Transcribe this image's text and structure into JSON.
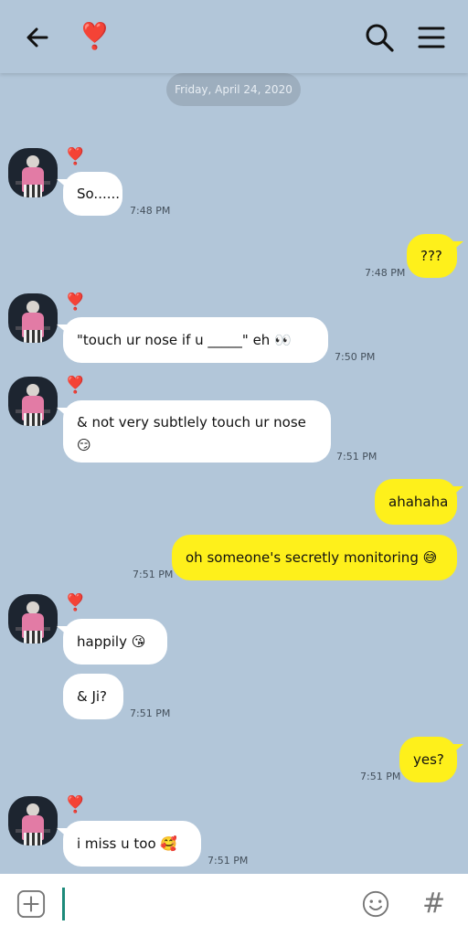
{
  "header": {
    "back_icon": "arrow-left-icon",
    "title_icon": "heart-exclamation-icon",
    "title_glyph": "❣️",
    "search_icon": "search-icon",
    "menu_icon": "hamburger-menu-icon"
  },
  "date_separator": "Friday, April 24, 2020",
  "contact_badge": "❣️",
  "messages": [
    {
      "side": "in",
      "text": "So......",
      "time": "7:48 PM"
    },
    {
      "side": "out",
      "text": "???",
      "time": "7:48 PM"
    },
    {
      "side": "in",
      "text": "\"touch ur nose if u _____\" eh 👀",
      "time": "7:50 PM"
    },
    {
      "side": "in",
      "line1": "& not very subtlely touch ur nose",
      "line2": "😏",
      "time": "7:51 PM"
    },
    {
      "side": "out",
      "text": "ahahaha",
      "time": ""
    },
    {
      "side": "out",
      "text": "oh someone's secretly monitoring 😅",
      "time": "7:51 PM"
    },
    {
      "side": "in",
      "text": "happily 😘",
      "time": ""
    },
    {
      "side": "in",
      "text": "& Ji?",
      "time": "7:51 PM"
    },
    {
      "side": "out",
      "text": "yes?",
      "time": "7:51 PM"
    },
    {
      "side": "in",
      "text": "i miss u too 🥰",
      "time": "7:51 PM"
    }
  ],
  "input_bar": {
    "plus_icon": "add-icon",
    "emoji_icon": "emoji-icon",
    "hash_icon": "hashtag-icon",
    "hash_glyph": "#"
  },
  "colors": {
    "background": "#b2c6d9",
    "incoming_bubble": "#ffffff",
    "outgoing_bubble": "#fef01b",
    "cursor": "#1d8a7a"
  }
}
